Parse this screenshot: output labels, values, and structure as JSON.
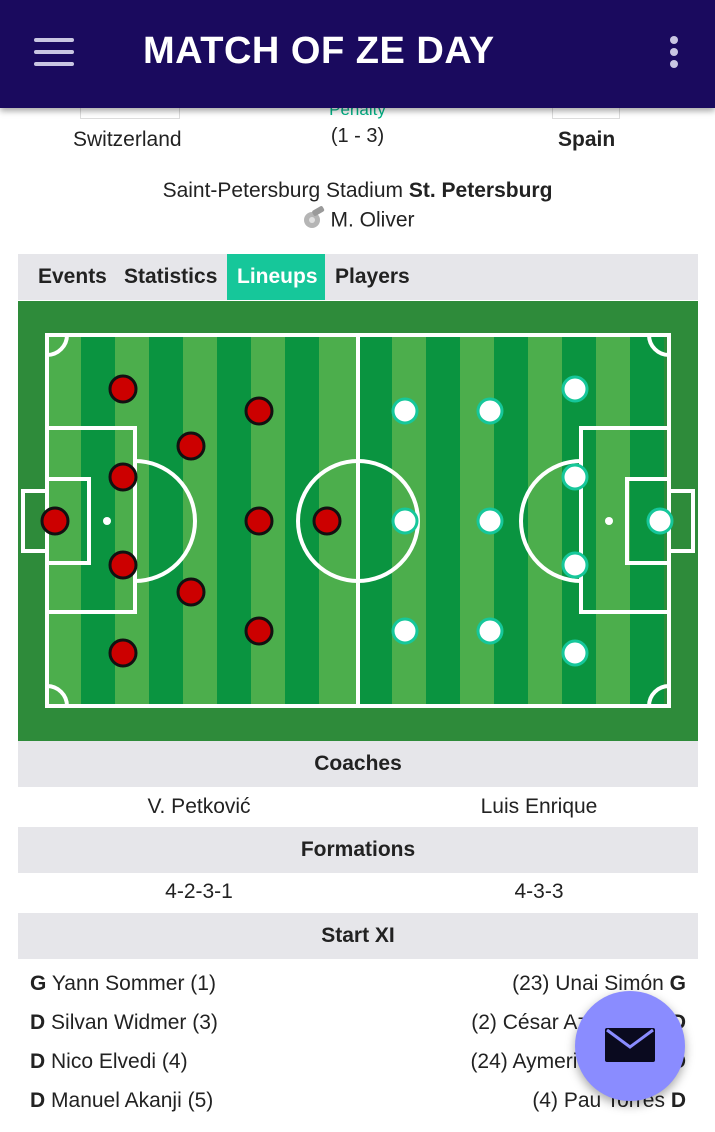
{
  "app": {
    "title": "MATCH OF ZE DAY"
  },
  "match": {
    "home_team": "Switzerland",
    "away_team": "Spain",
    "status": "Penalty",
    "penalty_score": "(1 - 3)",
    "venue_stadium": "Saint-Petersburg Stadium",
    "venue_city": "St. Petersburg",
    "referee": "M. Oliver"
  },
  "tabs": [
    {
      "label": "Events",
      "active": false
    },
    {
      "label": "Statistics",
      "active": false
    },
    {
      "label": "Lineups",
      "active": true
    },
    {
      "label": "Players",
      "active": false
    }
  ],
  "pitch": {
    "home_color": "#cc0000",
    "away_color": "#ffffff",
    "away_ring": "#16c79a"
  },
  "coaches": {
    "heading": "Coaches",
    "home": "V. Petković",
    "away": "Luis Enrique"
  },
  "formations": {
    "heading": "Formations",
    "home": "4-2-3-1",
    "away": "4-3-3"
  },
  "start_xi": {
    "heading": "Start XI",
    "home": [
      {
        "pos": "G",
        "name": "Yann Sommer (1)"
      },
      {
        "pos": "D",
        "name": "Silvan Widmer (3)"
      },
      {
        "pos": "D",
        "name": "Nico Elvedi (4)"
      },
      {
        "pos": "D",
        "name": "Manuel Akanji (5)"
      }
    ],
    "away": [
      {
        "pos": "G",
        "name": "(23) Unai Simón"
      },
      {
        "pos": "D",
        "name": "(2) César Azpilicueta"
      },
      {
        "pos": "D",
        "name": "(24) Aymeric Laporte"
      },
      {
        "pos": "D",
        "name": "(4) Pau Torres"
      }
    ]
  }
}
